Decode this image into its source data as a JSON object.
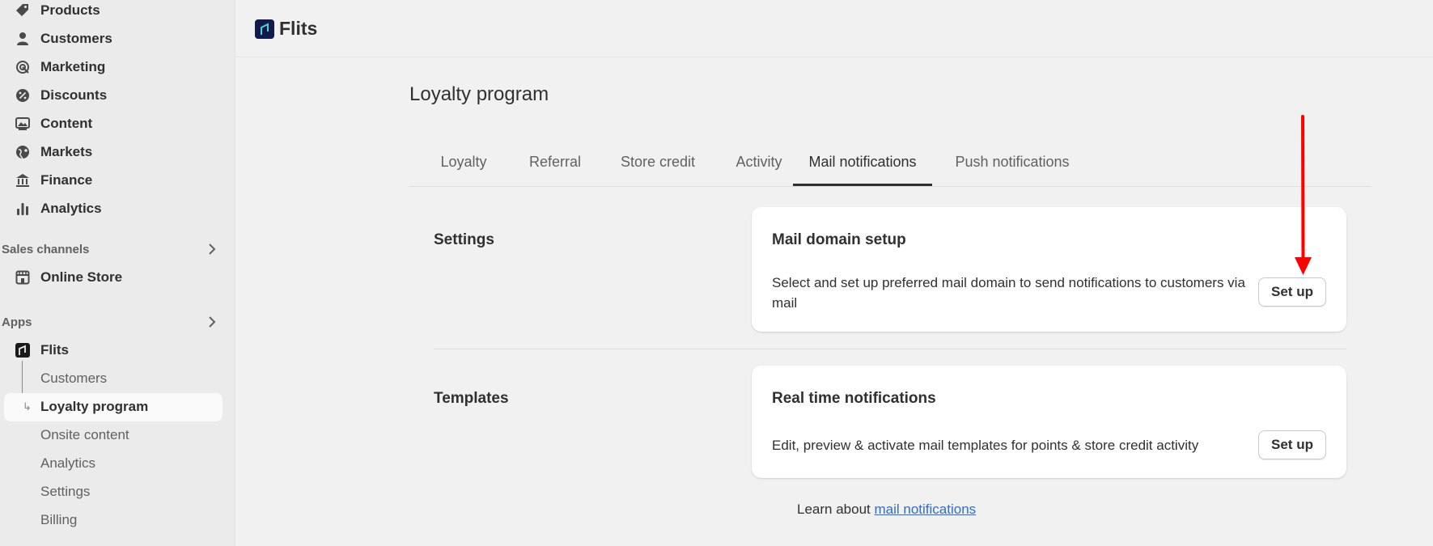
{
  "sidebar": {
    "main_items": [
      {
        "label": "Products",
        "icon": "tag-icon"
      },
      {
        "label": "Customers",
        "icon": "person-icon"
      },
      {
        "label": "Marketing",
        "icon": "target-icon"
      },
      {
        "label": "Discounts",
        "icon": "discount-icon"
      },
      {
        "label": "Content",
        "icon": "content-icon"
      },
      {
        "label": "Markets",
        "icon": "globe-icon"
      },
      {
        "label": "Finance",
        "icon": "bank-icon"
      },
      {
        "label": "Analytics",
        "icon": "bar-chart-icon"
      }
    ],
    "sales_channels": {
      "label": "Sales channels",
      "items": [
        {
          "label": "Online Store",
          "icon": "store-icon"
        }
      ]
    },
    "apps": {
      "label": "Apps",
      "app": {
        "label": "Flits",
        "icon": "flits-app-icon"
      },
      "sub_items": [
        "Customers",
        "Loyalty program",
        "Onsite content",
        "Analytics",
        "Settings",
        "Billing"
      ],
      "active_sub_item": "Loyalty program"
    }
  },
  "header": {
    "app_name": "Flits"
  },
  "main": {
    "page_title": "Loyalty program",
    "tabs": [
      "Loyalty",
      "Referral",
      "Store credit",
      "Activity",
      "Mail notifications",
      "Push notifications"
    ],
    "active_tab": "Mail notifications",
    "sections": [
      {
        "label": "Settings",
        "card": {
          "title": "Mail domain setup",
          "description": "Select and set up preferred mail domain to send notifications to customers via mail",
          "button": "Set up"
        }
      },
      {
        "label": "Templates",
        "card": {
          "title": "Real time notifications",
          "description": "Edit, preview & activate mail templates for points & store credit activity",
          "button": "Set up"
        }
      }
    ],
    "learn_prefix": "Learn about",
    "learn_link": "mail notifications"
  },
  "colors": {
    "annotation_arrow": "#ff0000",
    "link": "#2c6ecb",
    "app_logo": "#111a4f"
  }
}
